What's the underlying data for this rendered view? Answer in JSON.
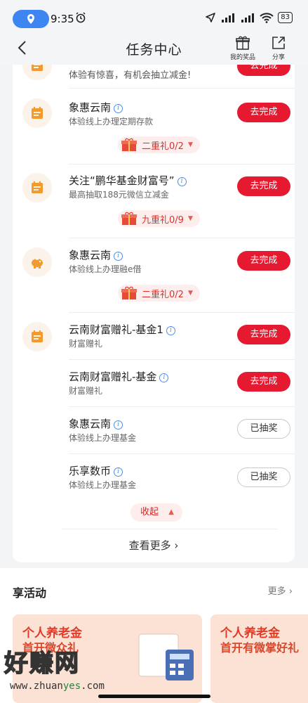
{
  "status_bar": {
    "time": "9:35",
    "battery": "83"
  },
  "nav": {
    "title": "任务中心",
    "prizes_label": "我的奖品",
    "share_label": "分享"
  },
  "top_partial": {
    "subtitle": "体验有惊喜，有机会抽立减金!",
    "button": "去完成"
  },
  "tasks": [
    {
      "title": "象惠云南",
      "subtitle": "体验线上办理定期存款",
      "button": "去完成",
      "gift": "二重礼0/2"
    },
    {
      "title": "关注“鹏华基金财富号”",
      "subtitle": "最高抽取188元微信立减金",
      "button": "去完成",
      "gift": "九重礼0/9"
    },
    {
      "title": "象惠云南",
      "subtitle": "体验线上办理融e借",
      "button": "去完成",
      "gift": "二重礼0/2"
    },
    {
      "title": "云南财富赠礼-基金1",
      "subtitle": "财富赠礼",
      "button": "去完成"
    },
    {
      "title": "云南财富赠礼-基金",
      "subtitle": "财富赠礼",
      "button": "去完成"
    },
    {
      "title": "象惠云南",
      "subtitle": "体验线上办理基金",
      "button": "已抽奖"
    },
    {
      "title": "乐享数币",
      "subtitle": "体验线上办理基金",
      "button": "已抽奖"
    }
  ],
  "collapse_label": "收起",
  "view_more": "查看更多",
  "activities": {
    "title": "享活动",
    "more": "更多",
    "banners": [
      {
        "line1": "个人养老金",
        "line2": "首开微众礼"
      },
      {
        "line1": "个人养老金",
        "line2": "首开有微掌好礼"
      }
    ]
  },
  "watermark": {
    "text": "好赚网",
    "url_prefix": "www.zhuan",
    "url_mid": "yes",
    "url_suffix": ".com"
  },
  "colors": {
    "primary_red": "#e5192f",
    "icon_orange": "#f39a2e",
    "info_blue": "#4d8ee8"
  }
}
